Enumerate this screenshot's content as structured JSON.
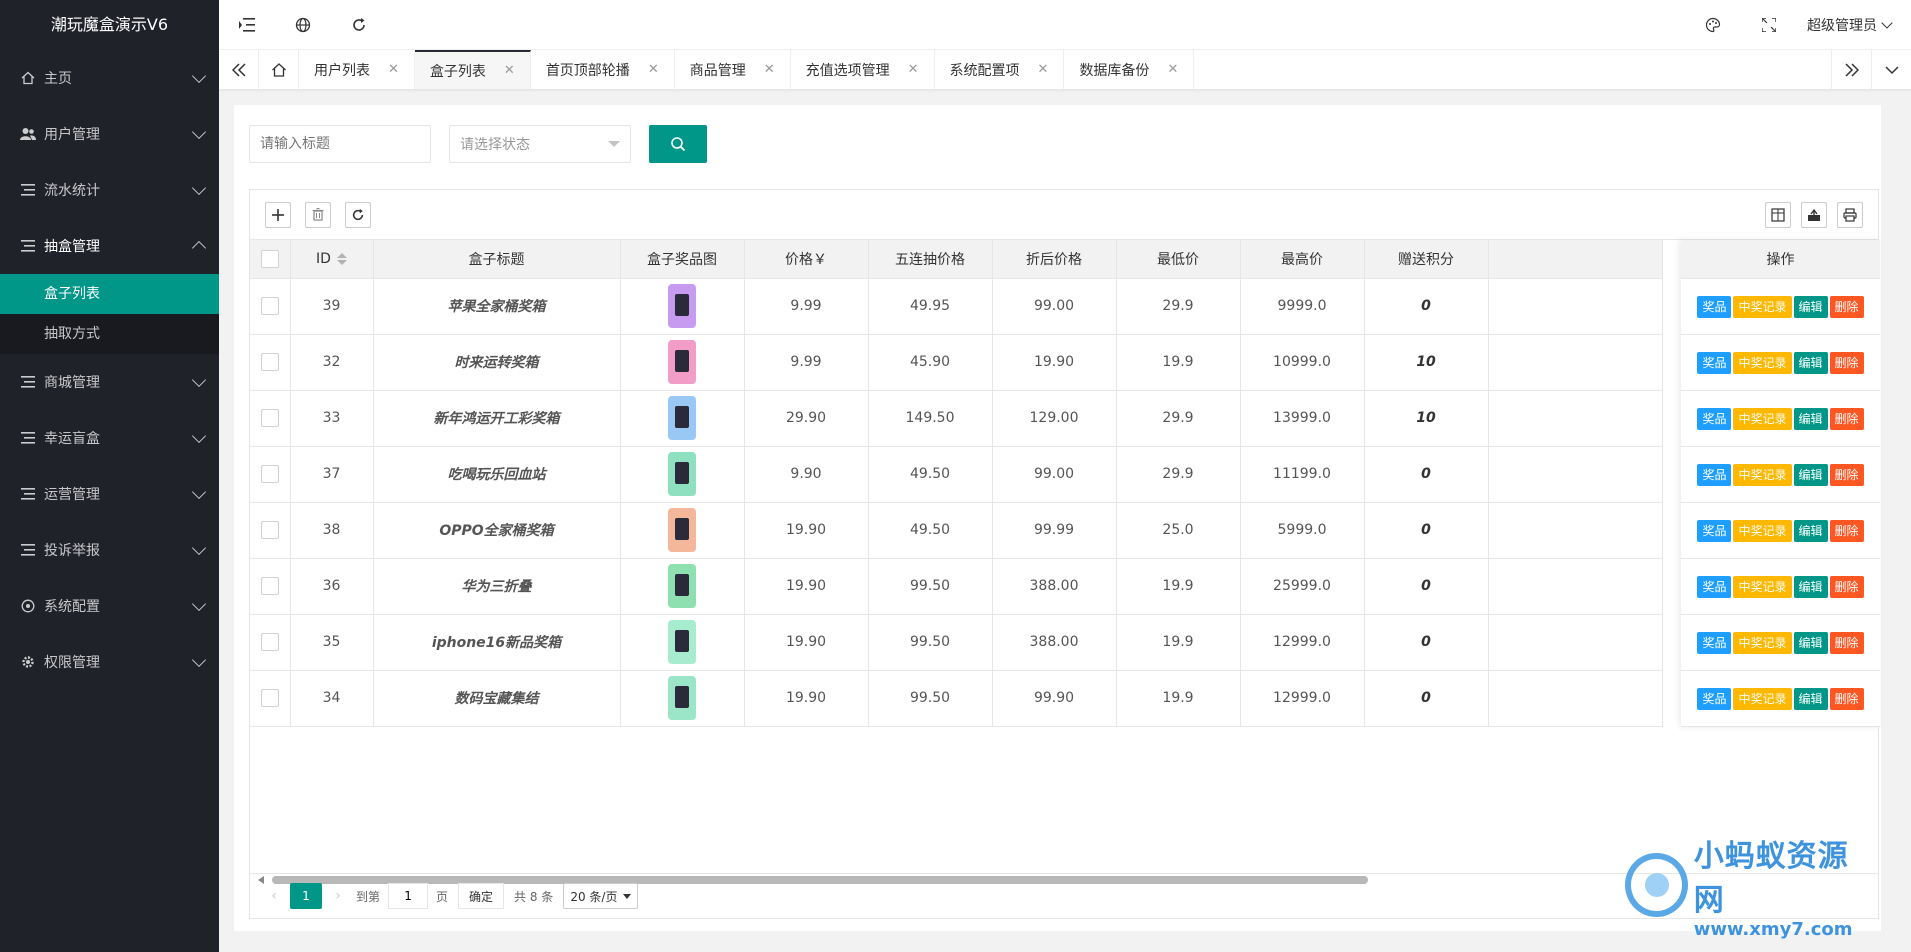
{
  "app": {
    "title": "潮玩魔盒演示V6"
  },
  "sidebar": {
    "items": [
      {
        "label": "主页",
        "icon": "home-icon",
        "open": false
      },
      {
        "label": "用户管理",
        "icon": "users-icon",
        "open": false
      },
      {
        "label": "流水统计",
        "icon": "list-icon",
        "open": false
      },
      {
        "label": "抽盒管理",
        "icon": "list-icon",
        "open": true,
        "children": [
          {
            "label": "盒子列表",
            "active": true
          },
          {
            "label": "抽取方式",
            "active": false
          }
        ]
      },
      {
        "label": "商城管理",
        "icon": "list-icon",
        "open": false
      },
      {
        "label": "幸运盲盒",
        "icon": "list-icon",
        "open": false
      },
      {
        "label": "运营管理",
        "icon": "list-icon",
        "open": false
      },
      {
        "label": "投诉举报",
        "icon": "list-icon",
        "open": false
      },
      {
        "label": "系统配置",
        "icon": "settings-circle-icon",
        "open": false
      },
      {
        "label": "权限管理",
        "icon": "gear-icon",
        "open": false
      }
    ]
  },
  "header": {
    "admin": "超级管理员"
  },
  "tabs": [
    {
      "label": "用户列表",
      "active": false
    },
    {
      "label": "盒子列表",
      "active": true
    },
    {
      "label": "首页顶部轮播",
      "active": false
    },
    {
      "label": "商品管理",
      "active": false
    },
    {
      "label": "充值选项管理",
      "active": false
    },
    {
      "label": "系统配置项",
      "active": false
    },
    {
      "label": "数据库备份",
      "active": false
    }
  ],
  "search": {
    "title_placeholder": "请输入标题",
    "status_placeholder": "请选择状态"
  },
  "table": {
    "columns": [
      "ID",
      "盒子标题",
      "盒子奖品图",
      "价格￥",
      "五连抽价格",
      "折后价格",
      "最低价",
      "最高价",
      "赠送积分",
      "操作"
    ],
    "rows": [
      {
        "id": "39",
        "title": "苹果全家桶奖箱",
        "thumb": "#c79cf0",
        "price": "9.99",
        "five": "49.95",
        "discount": "99.00",
        "min": "29.9",
        "max": "9999.0",
        "points": "0"
      },
      {
        "id": "32",
        "title": "时来运转奖箱",
        "thumb": "#f29cc8",
        "price": "9.99",
        "five": "45.90",
        "discount": "19.90",
        "min": "19.9",
        "max": "10999.0",
        "points": "10"
      },
      {
        "id": "33",
        "title": "新年鸿运开工彩奖箱",
        "thumb": "#9ac8f5",
        "price": "29.90",
        "five": "149.50",
        "discount": "129.00",
        "min": "29.9",
        "max": "13999.0",
        "points": "10"
      },
      {
        "id": "37",
        "title": "吃喝玩乐回血站",
        "thumb": "#8fe0c0",
        "price": "9.90",
        "five": "49.50",
        "discount": "99.00",
        "min": "29.9",
        "max": "11199.0",
        "points": "0"
      },
      {
        "id": "38",
        "title": "OPPO全家桶奖箱",
        "thumb": "#f5b79a",
        "price": "19.90",
        "five": "49.50",
        "discount": "99.99",
        "min": "25.0",
        "max": "5999.0",
        "points": "0"
      },
      {
        "id": "36",
        "title": "华为三折叠",
        "thumb": "#8fe0b0",
        "price": "19.90",
        "five": "99.50",
        "discount": "388.00",
        "min": "19.9",
        "max": "25999.0",
        "points": "0"
      },
      {
        "id": "35",
        "title": "iphone16新品奖箱",
        "thumb": "#a8ecd0",
        "price": "19.90",
        "five": "99.50",
        "discount": "388.00",
        "min": "19.9",
        "max": "12999.0",
        "points": "0"
      },
      {
        "id": "34",
        "title": "数码宝藏集结",
        "thumb": "#9be6c8",
        "price": "19.90",
        "five": "99.50",
        "discount": "99.90",
        "min": "19.9",
        "max": "12999.0",
        "points": "0"
      }
    ],
    "actions": {
      "prize": "奖品",
      "record": "中奖记录",
      "edit": "编辑",
      "delete": "删除"
    }
  },
  "pager": {
    "current": "1",
    "goto_label": "到第",
    "goto_value": "1",
    "page_unit": "页",
    "confirm": "确定",
    "total": "共 8 条",
    "page_size": "20 条/页"
  },
  "watermark": {
    "line1": "小蚂蚁资源网",
    "line2": "www.xmy7.com"
  }
}
